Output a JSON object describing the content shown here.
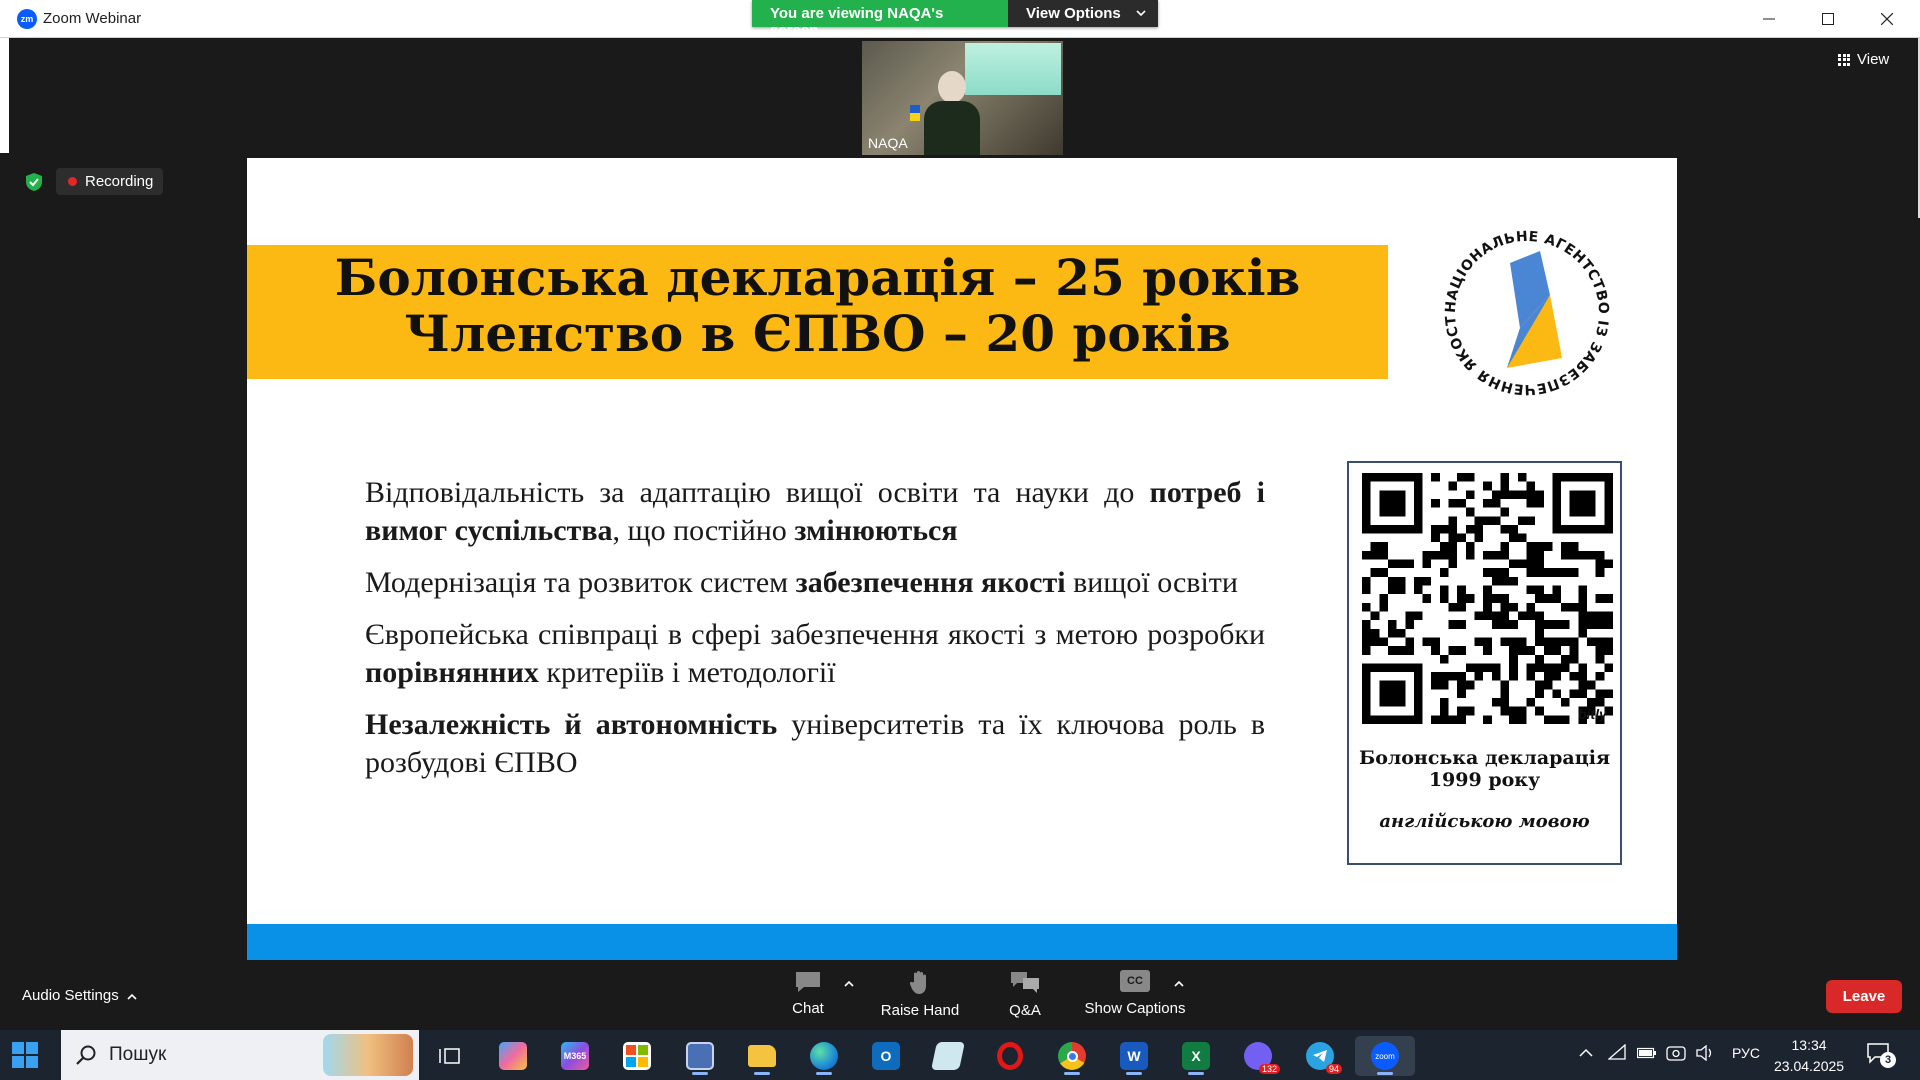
{
  "window": {
    "title": "Zoom Webinar",
    "logo_text": "zm"
  },
  "share_banner": {
    "status": "You are viewing NAQA's screen",
    "view_options": "View Options"
  },
  "participant": {
    "name": "NAQA"
  },
  "view_button": {
    "label": "View"
  },
  "recording": {
    "label": "Recording"
  },
  "slide": {
    "title_line1": "Болонська декларація – 25 років",
    "title_line2": "Членство в ЄПВО – 20 років",
    "logo_text": "НАЦІОНАЛЬНЕ АГЕНТСТВО ІЗ ЗАБЕЗПЕЧЕННЯ ЯКОСТІ ВИЩОЇ ОСВІТИ",
    "bullets": [
      {
        "p1": "Відповідальність за адаптацію вищої освіти та науки до ",
        "b1": "потреб і вимог суспільства",
        "p2": ", що постійно ",
        "b2": "змінюються",
        "p3": ""
      },
      {
        "p1": "Модернізація та розвиток систем ",
        "b1": "забезпечення якості",
        "p2": " вищої освіти",
        "b2": "",
        "p3": ""
      },
      {
        "p1": "Європейська співпраці в сфері забезпечення якості з метою розробки ",
        "b1": "порівнянних",
        "p2": " критеріїв і методології",
        "b2": "",
        "p3": ""
      },
      {
        "p1": "",
        "b1": "Незалежність й автономність",
        "p2": " університетів та їх ключова роль в розбудові ЄПВО",
        "b2": "",
        "p3": ""
      }
    ],
    "qr_brand": "bitly",
    "qr_caption1": "Болонська декларація",
    "qr_caption2": "1999 року",
    "qr_caption3": "англійською мовою"
  },
  "toolbar": {
    "audio_settings": "Audio Settings",
    "chat": "Chat",
    "raise_hand": "Raise Hand",
    "qa": "Q&A",
    "show_captions": "Show Captions",
    "cc": "CC",
    "leave": "Leave"
  },
  "taskbar": {
    "search_placeholder": "Пошук",
    "badge_viber": "132",
    "badge_telegram": "94",
    "badge_notifications": "3",
    "language": "РУС",
    "time": "13:34",
    "date": "23.04.2025",
    "m365_label": "M365",
    "zoom_label": "zoom",
    "word_letter": "W",
    "excel_letter": "X"
  },
  "colors": {
    "banner_yellow": "#fdb913",
    "slide_blue": "#0891e6",
    "share_green": "#23b14d",
    "leave_red": "#d82828"
  }
}
